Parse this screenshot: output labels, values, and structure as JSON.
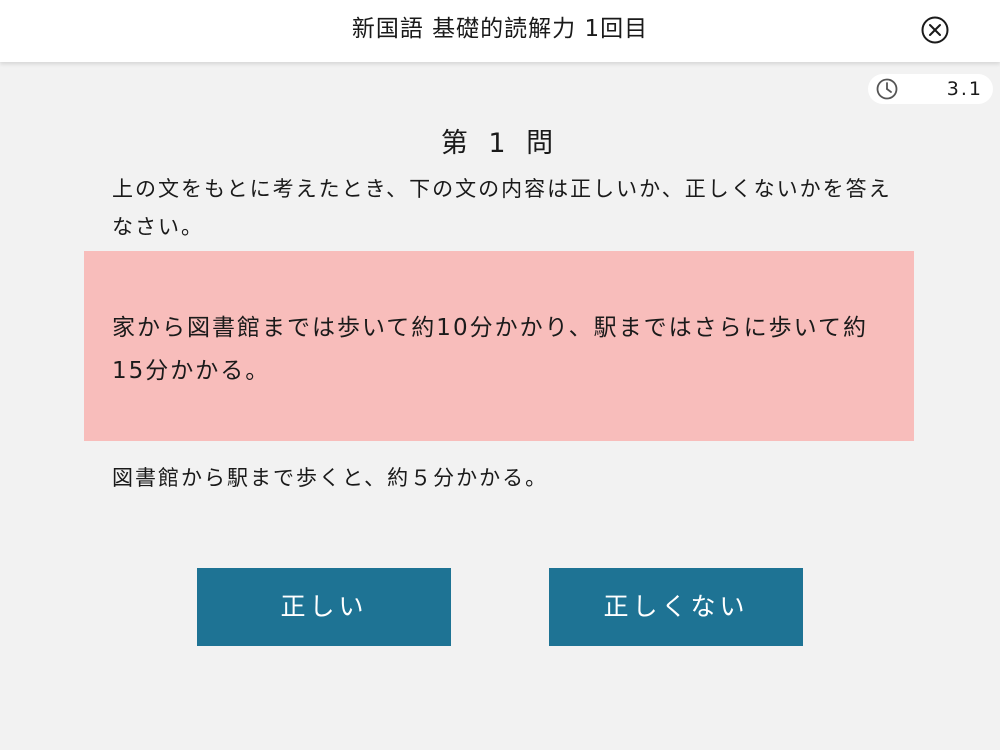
{
  "header": {
    "title": "新国語 基礎的読解力 1回目",
    "close_icon": "close-circle-icon"
  },
  "timer": {
    "icon": "clock-icon",
    "value": "3.1"
  },
  "question": {
    "number_label": "第 1 問",
    "instruction": "上の文をもとに考えたとき、下の文の内容は正しいか、正しくないかを答えなさい。",
    "passage": "家から図書館までは歩いて約10分かかり、駅まではさらに歩いて約15分かかる。",
    "statement": "図書館から駅まで歩くと、約５分かかる。"
  },
  "answers": {
    "true_label": "正しい",
    "false_label": "正しくない"
  },
  "colors": {
    "background": "#f2f2f2",
    "header_bg": "#ffffff",
    "passage_bg": "#f8bdbb",
    "button_bg": "#1e7394",
    "button_text": "#ffffff"
  }
}
